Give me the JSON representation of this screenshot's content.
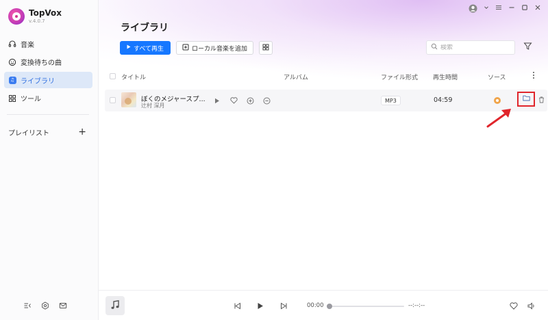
{
  "app": {
    "name": "TopVox",
    "version": "v.4.0.7"
  },
  "sidebar": {
    "items": [
      {
        "label": "音楽",
        "icon": "headphones-icon"
      },
      {
        "label": "変換待ちの曲",
        "icon": "clock-icon"
      },
      {
        "label": "ライブラリ",
        "icon": "library-icon",
        "active": true
      },
      {
        "label": "ツール",
        "icon": "grid-icon"
      }
    ],
    "playlist_label": "プレイリスト",
    "add_playlist": "+"
  },
  "main": {
    "title": "ライブラリ",
    "play_all": "すべて再生",
    "add_local": "ローカル音楽を追加",
    "search_placeholder": "検索"
  },
  "table": {
    "headers": {
      "title": "タイトル",
      "album": "アルバム",
      "format": "ファイル形式",
      "duration": "再生時間",
      "source": "ソース"
    },
    "rows": [
      {
        "title": "ぼくのメジャースプ...",
        "artist": "辻村 深月",
        "album": "",
        "format": "MP3",
        "duration": "04:59",
        "source_icon": "audible-icon"
      }
    ]
  },
  "player": {
    "current_time": "00:00",
    "total_time": "--:--:--",
    "progress": 0
  },
  "colors": {
    "accent": "#1677ff",
    "active_nav_bg": "#dde8f8",
    "highlight": "#e0252b"
  }
}
